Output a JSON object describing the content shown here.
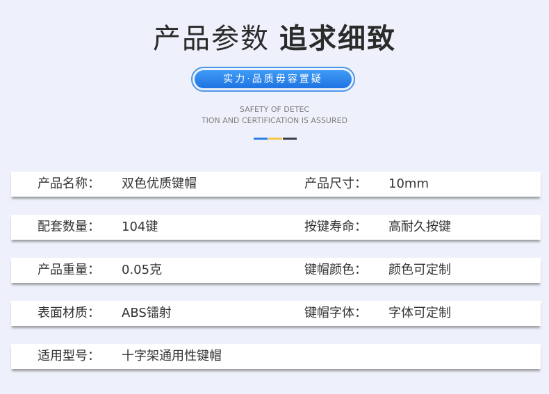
{
  "header": {
    "title_light": "产品参数",
    "title_bold": "追求细致",
    "badge": "实力·品质毋容置疑",
    "subtitle_line1": "SAFETY OF DETEC",
    "subtitle_line2": "TION AND CERTIFICATION IS ASSURED",
    "dash_colors": [
      "#2f7de8",
      "#f2c84b",
      "#3a3f4a"
    ]
  },
  "specs": [
    {
      "label": "产品名称：",
      "value": "双色优质键帽",
      "label2": "产品尺寸：",
      "value2": "10mm"
    },
    {
      "label": "配套数量：",
      "value": "104键",
      "label2": "按键寿命：",
      "value2": "高耐久按键"
    },
    {
      "label": "产品重量：",
      "value": "0.05克",
      "label2": "键帽颜色：",
      "value2": "颜色可定制"
    },
    {
      "label": "表面材质：",
      "value": "ABS镭射",
      "label2": "键帽字体：",
      "value2": "字体可定制"
    },
    {
      "label": "适用型号：",
      "value": "十字架通用性键帽"
    }
  ]
}
